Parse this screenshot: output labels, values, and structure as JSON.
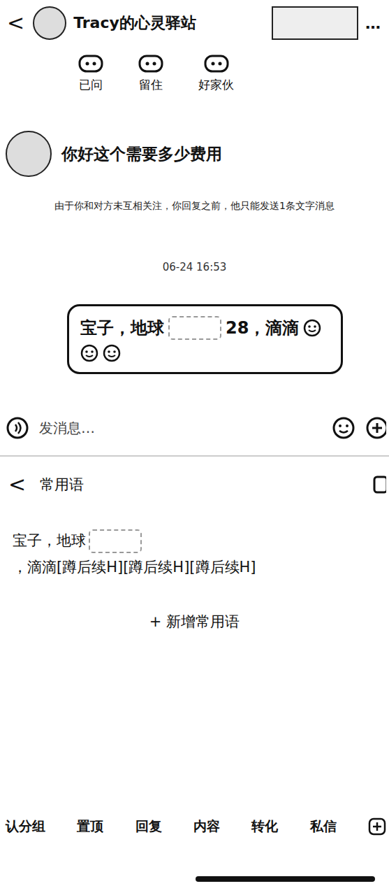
{
  "header": {
    "back": "<",
    "title": "Tracy的心灵驿站",
    "more": "…"
  },
  "tags": [
    {
      "label": "已问"
    },
    {
      "label": "留住"
    },
    {
      "label": "好家伙"
    }
  ],
  "messages": [
    {
      "text": "你好这个需要多少费用"
    }
  ],
  "notice": "由于你和对方未互相关注，你回复之前，他只能发送1条文字消息",
  "time": "06-24 16:53",
  "draft": {
    "before": "宝子，地球",
    "after": "28，滴滴"
  },
  "input": {
    "placeholder": "发消息…"
  },
  "phrases_panel": {
    "back": "<",
    "title": "常用语",
    "items": [
      {
        "before": "宝子，地球",
        "after": "，滴滴[蹲后续H][蹲后续H][蹲后续H]"
      }
    ],
    "add": "+ 新增常用语"
  },
  "toolbar": [
    "认分组",
    "置顶",
    "回复",
    "内容",
    "转化",
    "私信"
  ]
}
